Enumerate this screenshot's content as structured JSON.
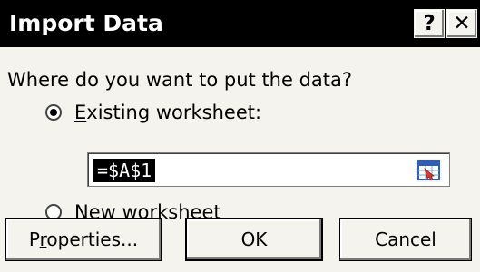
{
  "window": {
    "title": "Import Data",
    "help_icon": "question-mark-icon",
    "close_icon": "close-icon",
    "help_label": "?",
    "close_label": "✕"
  },
  "prompt": "Where do you want to put the data?",
  "options": {
    "existing": {
      "label_underlined": "E",
      "label_rest": "xisting worksheet:",
      "selected": true
    },
    "new": {
      "label_underlined": "N",
      "label_rest": "ew worksheet",
      "selected": false
    }
  },
  "range": {
    "value": "=$A$1",
    "picker_icon": "range-selector-icon"
  },
  "buttons": {
    "properties_pre": "P",
    "properties_underlined": "r",
    "properties_post": "operties...",
    "ok": "OK",
    "cancel": "Cancel"
  },
  "colors": {
    "titlebar": "#000000",
    "dialog_bg": "#f4f3ee",
    "picker_red": "#d93a2a",
    "picker_blue": "#2d5fb8"
  }
}
